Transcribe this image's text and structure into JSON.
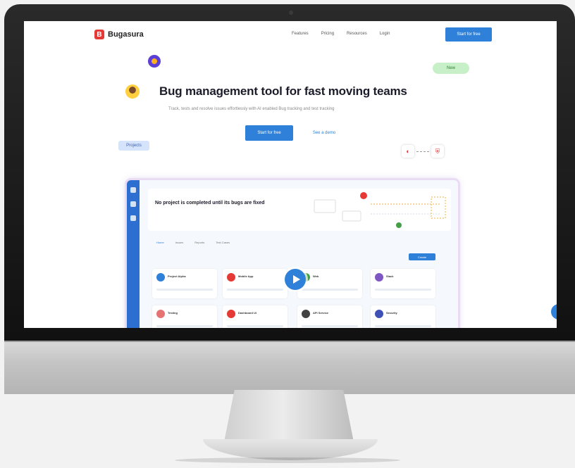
{
  "site": {
    "logo_text": "Bugasura",
    "logo_mark": "B",
    "nav_links": [
      "Features",
      "Pricing",
      "Resources",
      "Login"
    ],
    "nav_cta": "Start for free",
    "badge_green": "New",
    "badge_blue": "Projects",
    "hero_title": "Bug management tool for fast moving teams",
    "hero_subtitle": "Track, tests and resolve issues effortlessly with AI enabled Bug tracking and test tracking",
    "hero_button": "Start for free",
    "hero_link": "See a demo"
  },
  "preview": {
    "title": "No project is completed until its bugs are fixed",
    "tabs": [
      "Home",
      "Issues",
      "Reports",
      "Test Cases"
    ],
    "create_label": "Create",
    "cards": [
      {
        "name": "Project Alpha",
        "color": "#2f80d8"
      },
      {
        "name": "Mobile App",
        "color": "#e53935"
      },
      {
        "name": "Web",
        "color": "#43a047"
      },
      {
        "name": "Slack",
        "color": "#7e57c2"
      },
      {
        "name": "Testing",
        "color": "#e57373"
      },
      {
        "name": "Dashboard UI",
        "color": "#e53935"
      },
      {
        "name": "API Service",
        "color": "#424242"
      },
      {
        "name": "Security",
        "color": "#3f51b5"
      }
    ]
  },
  "colors": {
    "accent": "#2f80d8",
    "brand": "#e53935"
  }
}
